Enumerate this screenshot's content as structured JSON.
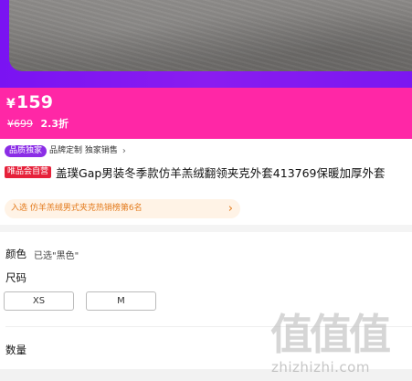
{
  "price": {
    "currency": "¥",
    "amount": "159",
    "original": "¥699",
    "discount": "2.3折"
  },
  "tags": {
    "purple_badge": "品质独家",
    "brand_text": "品牌定制 独家销售",
    "chevron": "›"
  },
  "product": {
    "store_badge": "唯品会自营",
    "title": "盖璞Gap男装冬季款仿羊羔绒翻领夹克外套413769保暖加厚外套"
  },
  "rank": {
    "text": "入选 仿羊羔绒男式夹克热销榜第6名",
    "arrow": "›"
  },
  "options": {
    "color_label": "颜色",
    "color_value": "已选\"黑色\"",
    "size_label": "尺码",
    "sizes": [
      "XS",
      "M"
    ],
    "quantity_label": "数量"
  },
  "watermark": {
    "big": "值值值",
    "small": "zhizhizhi.com"
  },
  "colors": {
    "price_band": "#ff27a6",
    "hero_purple": "#7a13f2",
    "rank_orange": "#e37b1d",
    "store_badge_red": "#e6213a"
  }
}
